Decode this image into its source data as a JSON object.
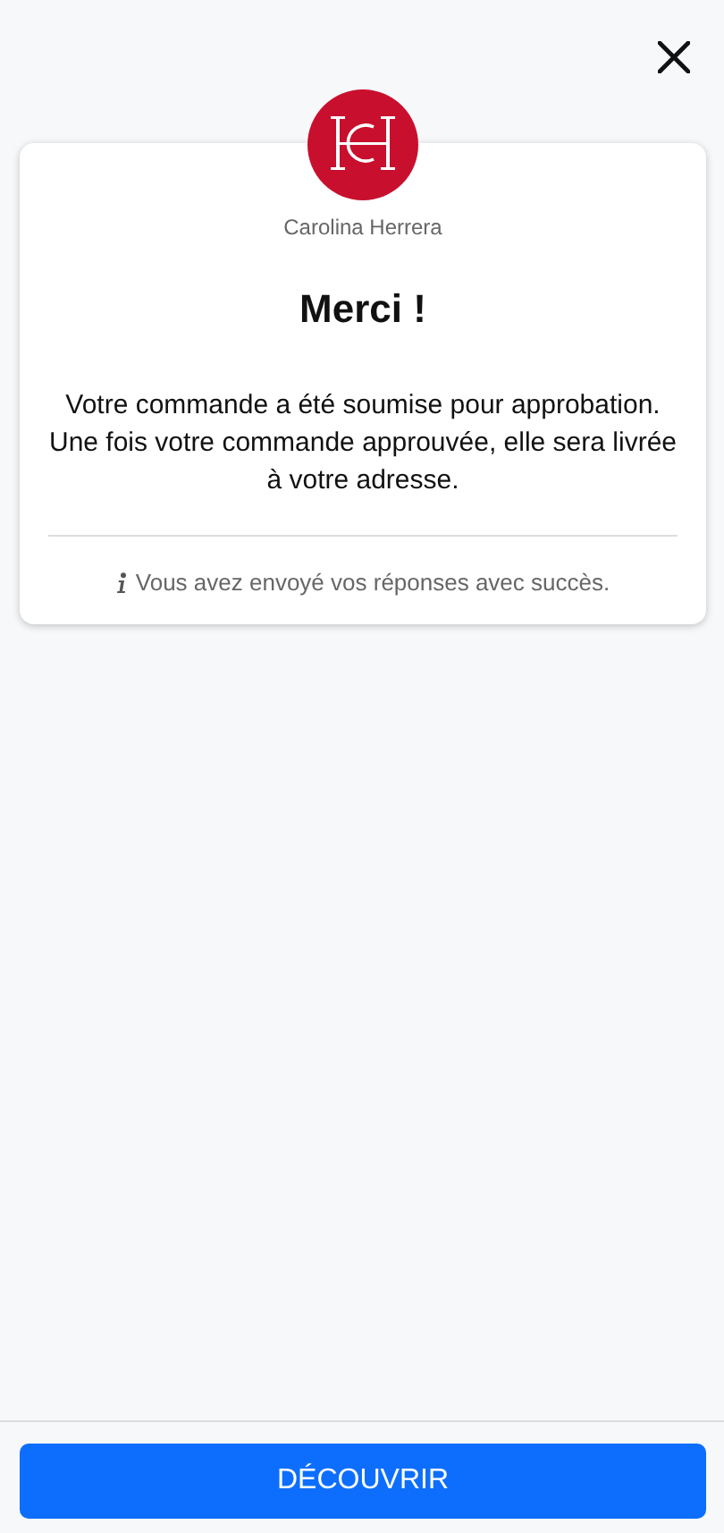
{
  "brand": {
    "name": "Carolina Herrera"
  },
  "title": "Merci !",
  "message": "Votre commande a été soumise pour approbation. Une fois votre commande approuvée, elle sera livrée à votre adresse.",
  "info": "Vous avez envoyé vos réponses avec succès.",
  "action": {
    "label": "DÉCOUVRIR"
  }
}
